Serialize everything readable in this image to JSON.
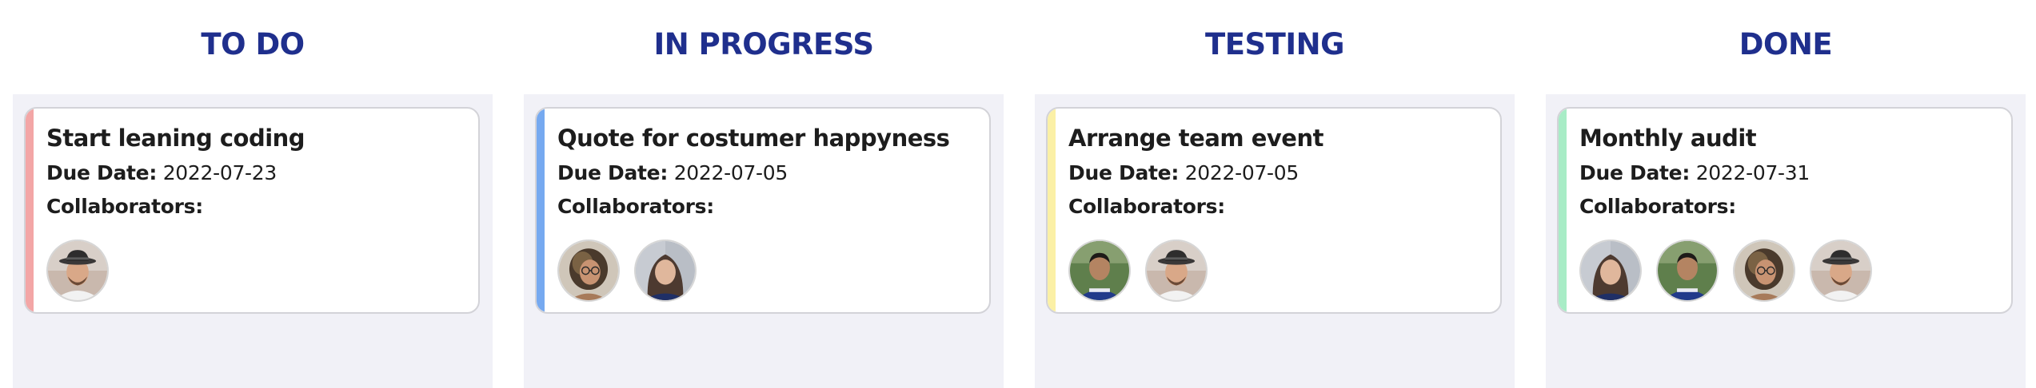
{
  "colors": {
    "title": "#1f2f8d",
    "column_bg": "#f1f1f7",
    "accent_todo": "#f3a6a6",
    "accent_in_progress": "#76a9f0",
    "accent_testing": "#fbf0a6",
    "accent_done": "#a8ecc6"
  },
  "columns": [
    {
      "title": "TO DO",
      "card": {
        "title": "Start leaning coding",
        "due_label": "Due Date:",
        "due_date": "2022-07-23",
        "collaborators_label": "Collaborators:",
        "collaborators": [
          "avatar-man-hat"
        ]
      }
    },
    {
      "title": "IN PROGRESS",
      "card": {
        "title": "Quote for costumer happyness",
        "due_label": "Due Date:",
        "due_date": "2022-07-05",
        "collaborators_label": "Collaborators:",
        "collaborators": [
          "avatar-woman-glasses",
          "avatar-woman-dark-hair"
        ]
      }
    },
    {
      "title": "TESTING",
      "card": {
        "title": "Arrange team event",
        "due_label": "Due Date:",
        "due_date": "2022-07-05",
        "collaborators_label": "Collaborators:",
        "collaborators": [
          "avatar-man-outdoor",
          "avatar-man-hat"
        ]
      }
    },
    {
      "title": "DONE",
      "card": {
        "title": "Monthly audit",
        "due_label": "Due Date:",
        "due_date": "2022-07-31",
        "collaborators_label": "Collaborators:",
        "collaborators": [
          "avatar-woman-dark-hair",
          "avatar-man-outdoor",
          "avatar-woman-glasses",
          "avatar-man-hat"
        ]
      }
    }
  ]
}
